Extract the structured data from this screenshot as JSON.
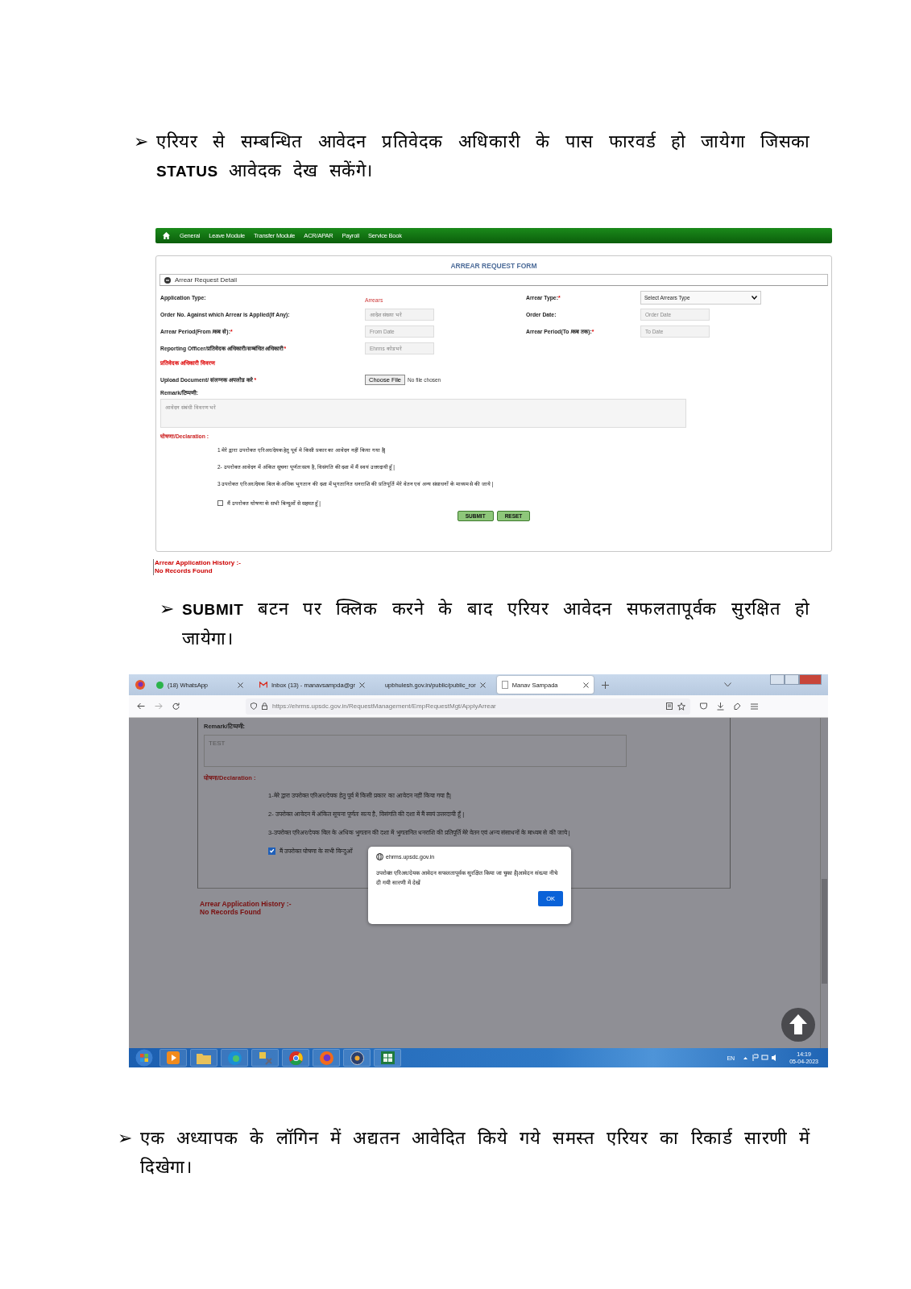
{
  "step_1": {
    "bullet": "➢",
    "text": "एरियर से सम्बन्धित आवेदन प्रतिवेदक अधिकारी के पास फारवर्ड हो जायेगा जिसका **STATUS** आवेदक देख सकेंगे।"
  },
  "form_screenshot": {
    "nav": {
      "items": [
        "General",
        "Leave Module",
        "Transfer Module",
        "ACR/APAR",
        "Payroll",
        "Service Book"
      ]
    },
    "title": "ARREAR REQUEST FORM",
    "section_title": "Arrear Request Detail",
    "rows": [
      [
        {
          "label": "Application Type:",
          "control": {
            "kind": "text",
            "value": "Arrears"
          }
        },
        {
          "label": "Arrear Type:",
          "required_mark": "*",
          "control": {
            "kind": "select",
            "value": "Select Arrears Type"
          }
        }
      ],
      [
        {
          "label": "Order No. Against which Arrear is Applied(If Any):",
          "control": {
            "kind": "input",
            "placeholder": "आदेश संख्या भरे"
          }
        },
        {
          "label": "Order Date:",
          "control": {
            "kind": "input",
            "placeholder": "Order Date"
          }
        }
      ],
      [
        {
          "label": "Arrear Period(From /कब से):",
          "required_mark": "*",
          "control": {
            "kind": "input",
            "placeholder": "From Date"
          }
        },
        {
          "label": "Arrear Period(To /कब तक):",
          "required_mark": "*",
          "control": {
            "kind": "input",
            "placeholder": "To Date"
          }
        }
      ],
      [
        {
          "label": "Reporting Officer/प्रतिवेदक अधिकारी/सम्बंधित अधिकारी",
          "required_mark": "*",
          "control": {
            "kind": "input",
            "placeholder": "Ehrms कोड भरे"
          }
        }
      ]
    ],
    "officer_link": "प्रतिवेदक अधिकारी विवरण",
    "upload": {
      "label": "Upload Document/ संलग्नक अपलोड करे",
      "required_mark": "*",
      "button": "Choose File",
      "status": "No file chosen"
    },
    "remark": {
      "label": "Remark/टिप्पणी:",
      "placeholder": "आवेदन संबंधी विवरण भरे"
    },
    "declaration_title": "घोषणा/Declaration :",
    "points": [
      "1 मेरे द्वारा उपरोक्त एरिअर/देयक हेतु पूर्व मे किसी प्रकार का आवेदन नहीं किया गया है|",
      "2- उपरोक्त आवेदन में अंकित सूचना पूर्णतः सत्य है, विसंगति की दशा में मैं स्वयं उत्तरदायी हूँ |",
      "3 उपरोक्त एरिअर/देयक बिल के अधिक भुगतान की दशा में भुगतानित धनराशि की प्रतिपूर्ति मेरे वेतन एवं अन्य संसाधनों के माध्यम से की जाये |"
    ],
    "agree": {
      "text": "मैं उपरोक्त घोषणा के सभी बिन्दुओं से सहमत हूँ |",
      "checked": false
    },
    "buttons": [
      "SUBMIT",
      "RESET"
    ],
    "history": {
      "title": "Arrear Application History :-",
      "empty": "No Records Found"
    }
  },
  "step_2": {
    "bullet": "➢",
    "text": "**SUBMIT** बटन पर क्लिक करने के बाद एरियर आवेदन सफलतापूर्वक सुरक्षित हो जायेगा।"
  },
  "browser_screenshot": {
    "tabs": [
      {
        "title": "(18) WhatsApp",
        "kind": "chat",
        "selected": false
      },
      {
        "title": "Inbox (13) - manavsampda@gr",
        "kind": "mail",
        "selected": false
      },
      {
        "title": "upbhulesh.gov.in/public/public_ror",
        "kind": "page",
        "selected": false
      },
      {
        "title": "Manav Sampada",
        "kind": "document",
        "selected": true
      }
    ],
    "url": "https://ehrms.upsdc.gov.in/RequestManagement/EmpRequestMgt/ApplyArrear",
    "remark": {
      "label": "Remark/टिप्पणी:",
      "value": "TEST"
    },
    "declaration_title": "घोषणा/Declaration :",
    "points": [
      "1-मेरे द्वारा उपरोक्त एरिअर/देयक हेतु पूर्व में किसी प्रकार का आवेदन नहीं किया गया है|",
      "2- उपरोक्त आवेदन में अंकित सूचना पूर्णतः सत्य है, विसंगति की दशा में मैं स्वयं उत्तरदायी हूँ |",
      "3-उपरोक्त एरिअर/देयक बिल के अधिक भुगतान की दशा में भुगतानित धनराशि की प्रतिपूर्ति मेरे वेतन एवं अन्य संसाधनों के माध्यम से की जाये |"
    ],
    "agree": {
      "text": "मैं उपरोक्त घोषणा के सभी बिन्दुओं",
      "checked": true
    },
    "history": {
      "title": "Arrear Application History :-",
      "empty": "No Records Found"
    },
    "dialog": {
      "origin": "ehrms.upsdc.gov.in",
      "message": "उपरोक्त एरिअर/देयक आवेदन सफलतापूर्वक सुरक्षित किया जा चुका है|आवेदन संख्या नीचे दी गयी सारणी में देखें",
      "button": "OK"
    },
    "taskbar": {
      "language": "EN",
      "time": "14:19",
      "date": "05-04-2023"
    }
  },
  "step_3": {
    "bullet": "➢",
    "text": "एक अध्यापक के लॉगिन में अद्यतन आवेदित किये गये समस्त एरियर का रिकार्ड सारणी में दिखेगा।"
  }
}
